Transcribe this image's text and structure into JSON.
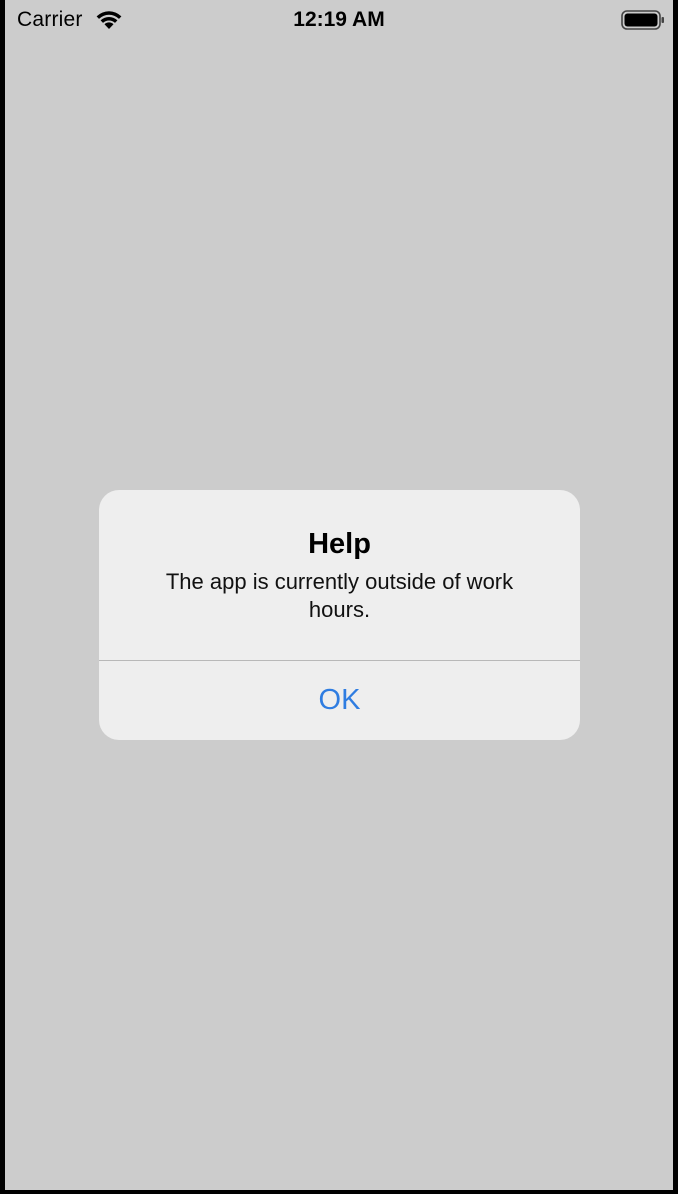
{
  "status_bar": {
    "carrier": "Carrier",
    "time": "12:19 AM",
    "wifi_icon": "wifi-icon",
    "battery_icon": "battery-full-icon"
  },
  "alert": {
    "title": "Help",
    "message": "The app is currently outside of work hours.",
    "ok_label": "OK"
  },
  "colors": {
    "background": "#cccccc",
    "alert_background": "#eeeeee",
    "accent": "#2f7de1"
  }
}
